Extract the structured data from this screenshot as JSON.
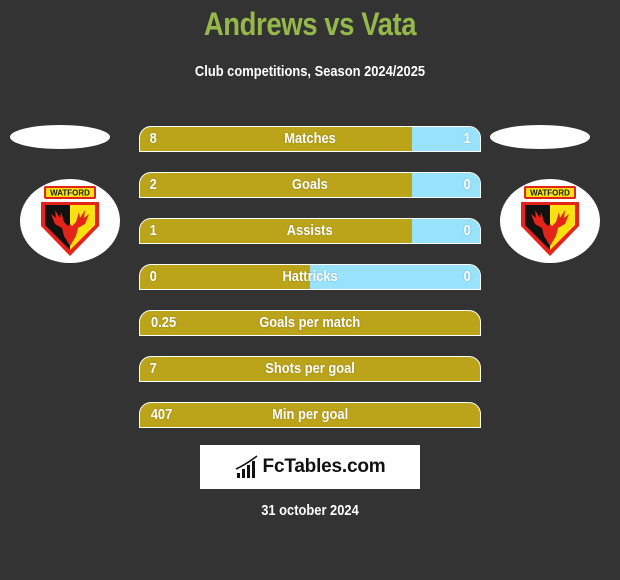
{
  "header": {
    "title": "Andrews vs Vata",
    "subtitle": "Club competitions, Season 2024/2025"
  },
  "players": {
    "left": {
      "name": "Andrews",
      "club_badge": "watford-crest",
      "badge_text": "WATFORD"
    },
    "right": {
      "name": "Vata",
      "club_badge": "watford-crest",
      "badge_text": "WATFORD"
    }
  },
  "colors": {
    "background": "#333333",
    "title": "#95b84a",
    "left_bar": "#bba41a",
    "right_bar": "#98e2fc",
    "text": "#ffffff"
  },
  "stats": [
    {
      "label": "Matches",
      "left": "8",
      "right": "1",
      "right_share": 0.2
    },
    {
      "label": "Goals",
      "left": "2",
      "right": "0",
      "right_share": 0.2
    },
    {
      "label": "Assists",
      "left": "1",
      "right": "0",
      "right_share": 0.2
    },
    {
      "label": "Hattricks",
      "left": "0",
      "right": "0",
      "right_share": 0.5
    },
    {
      "label": "Goals per match",
      "left": "0.25",
      "right": "",
      "right_share": 0
    },
    {
      "label": "Shots per goal",
      "left": "7",
      "right": "",
      "right_share": 0
    },
    {
      "label": "Min per goal",
      "left": "407",
      "right": "",
      "right_share": 0
    }
  ],
  "brand": {
    "name": "FcTables.com",
    "icon": "bar-chart-trend-icon"
  },
  "footer": {
    "date": "31 october 2024"
  }
}
